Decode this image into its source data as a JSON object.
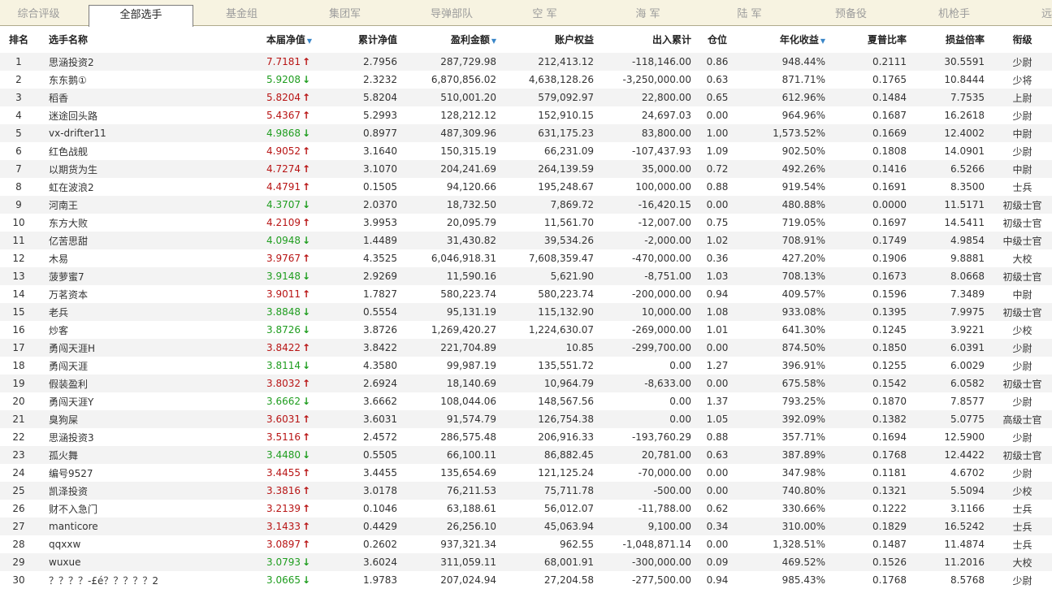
{
  "tabs": [
    "综合评级",
    "全部选手",
    "基金组",
    "集团军",
    "导弹部队",
    "空 军",
    "海 军",
    "陆 军",
    "预备役",
    "机枪手",
    "远征"
  ],
  "active_tab": 1,
  "headers": {
    "rank": "排名",
    "name": "选手名称",
    "nav": "本届净值",
    "cum_nav": "累计净值",
    "profit": "盈利金额",
    "equity": "账户权益",
    "inout": "出入累计",
    "position": "仓位",
    "annual": "年化收益",
    "sharpe": "夏普比率",
    "pl_ratio": "损益倍率",
    "grade": "衔级"
  },
  "sortable_columns": [
    "nav",
    "profit",
    "annual"
  ],
  "colors": {
    "up": "#b81414",
    "down": "#1f9d1f",
    "sort_indicator": "#3a86c8"
  },
  "rows": [
    {
      "rank": "1",
      "name": "思涵投资2",
      "nav": "7.7181",
      "dir": "up",
      "cum": "2.7956",
      "profit": "287,729.98",
      "equity": "212,413.12",
      "inout": "-118,146.00",
      "pos": "0.86",
      "annual": "948.44%",
      "sharpe": "0.2111",
      "ratio": "30.5591",
      "grade": "少尉"
    },
    {
      "rank": "2",
      "name": "东东鹅①",
      "nav": "5.9208",
      "dir": "down",
      "cum": "2.3232",
      "profit": "6,870,856.02",
      "equity": "4,638,128.26",
      "inout": "-3,250,000.00",
      "pos": "0.63",
      "annual": "871.71%",
      "sharpe": "0.1765",
      "ratio": "10.8444",
      "grade": "少将"
    },
    {
      "rank": "3",
      "name": "稻香",
      "nav": "5.8204",
      "dir": "up",
      "cum": "5.8204",
      "profit": "510,001.20",
      "equity": "579,092.97",
      "inout": "22,800.00",
      "pos": "0.65",
      "annual": "612.96%",
      "sharpe": "0.1484",
      "ratio": "7.7535",
      "grade": "上尉"
    },
    {
      "rank": "4",
      "name": "迷途回头路",
      "nav": "5.4367",
      "dir": "up",
      "cum": "5.2993",
      "profit": "128,212.12",
      "equity": "152,910.15",
      "inout": "24,697.03",
      "pos": "0.00",
      "annual": "964.96%",
      "sharpe": "0.1687",
      "ratio": "16.2618",
      "grade": "少尉"
    },
    {
      "rank": "5",
      "name": "vx-drifter11",
      "nav": "4.9868",
      "dir": "down",
      "cum": "0.8977",
      "profit": "487,309.96",
      "equity": "631,175.23",
      "inout": "83,800.00",
      "pos": "1.00",
      "annual": "1,573.52%",
      "sharpe": "0.1669",
      "ratio": "12.4002",
      "grade": "中尉"
    },
    {
      "rank": "6",
      "name": "红色战舰",
      "nav": "4.9052",
      "dir": "up",
      "cum": "3.1640",
      "profit": "150,315.19",
      "equity": "66,231.09",
      "inout": "-107,437.93",
      "pos": "1.09",
      "annual": "902.50%",
      "sharpe": "0.1808",
      "ratio": "14.0901",
      "grade": "少尉"
    },
    {
      "rank": "7",
      "name": "以期货为生",
      "nav": "4.7274",
      "dir": "up",
      "cum": "3.1070",
      "profit": "204,241.69",
      "equity": "264,139.59",
      "inout": "35,000.00",
      "pos": "0.72",
      "annual": "492.26%",
      "sharpe": "0.1416",
      "ratio": "6.5266",
      "grade": "中尉"
    },
    {
      "rank": "8",
      "name": "虹在波浪2",
      "nav": "4.4791",
      "dir": "up",
      "cum": "0.1505",
      "profit": "94,120.66",
      "equity": "195,248.67",
      "inout": "100,000.00",
      "pos": "0.88",
      "annual": "919.54%",
      "sharpe": "0.1691",
      "ratio": "8.3500",
      "grade": "士兵"
    },
    {
      "rank": "9",
      "name": "河南王",
      "nav": "4.3707",
      "dir": "down",
      "cum": "2.0370",
      "profit": "18,732.50",
      "equity": "7,869.72",
      "inout": "-16,420.15",
      "pos": "0.00",
      "annual": "480.88%",
      "sharpe": "0.0000",
      "ratio": "11.5171",
      "grade": "初级士官"
    },
    {
      "rank": "10",
      "name": "东方大败",
      "nav": "4.2109",
      "dir": "up",
      "cum": "3.9953",
      "profit": "20,095.79",
      "equity": "11,561.70",
      "inout": "-12,007.00",
      "pos": "0.75",
      "annual": "719.05%",
      "sharpe": "0.1697",
      "ratio": "14.5411",
      "grade": "初级士官"
    },
    {
      "rank": "11",
      "name": "亿苦思甜",
      "nav": "4.0948",
      "dir": "down",
      "cum": "1.4489",
      "profit": "31,430.82",
      "equity": "39,534.26",
      "inout": "-2,000.00",
      "pos": "1.02",
      "annual": "708.91%",
      "sharpe": "0.1749",
      "ratio": "4.9854",
      "grade": "中级士官"
    },
    {
      "rank": "12",
      "name": "木易",
      "nav": "3.9767",
      "dir": "up",
      "cum": "4.3525",
      "profit": "6,046,918.31",
      "equity": "7,608,359.47",
      "inout": "-470,000.00",
      "pos": "0.36",
      "annual": "427.20%",
      "sharpe": "0.1906",
      "ratio": "9.8881",
      "grade": "大校"
    },
    {
      "rank": "13",
      "name": "菠萝蜜7",
      "nav": "3.9148",
      "dir": "down",
      "cum": "2.9269",
      "profit": "11,590.16",
      "equity": "5,621.90",
      "inout": "-8,751.00",
      "pos": "1.03",
      "annual": "708.13%",
      "sharpe": "0.1673",
      "ratio": "8.0668",
      "grade": "初级士官"
    },
    {
      "rank": "14",
      "name": "万茗资本",
      "nav": "3.9011",
      "dir": "up",
      "cum": "1.7827",
      "profit": "580,223.74",
      "equity": "580,223.74",
      "inout": "-200,000.00",
      "pos": "0.94",
      "annual": "409.57%",
      "sharpe": "0.1596",
      "ratio": "7.3489",
      "grade": "中尉"
    },
    {
      "rank": "15",
      "name": "老兵",
      "nav": "3.8848",
      "dir": "down",
      "cum": "0.5554",
      "profit": "95,131.19",
      "equity": "115,132.90",
      "inout": "10,000.00",
      "pos": "1.08",
      "annual": "933.08%",
      "sharpe": "0.1395",
      "ratio": "7.9975",
      "grade": "初级士官"
    },
    {
      "rank": "16",
      "name": "炒客",
      "nav": "3.8726",
      "dir": "down",
      "cum": "3.8726",
      "profit": "1,269,420.27",
      "equity": "1,224,630.07",
      "inout": "-269,000.00",
      "pos": "1.01",
      "annual": "641.30%",
      "sharpe": "0.1245",
      "ratio": "3.9221",
      "grade": "少校"
    },
    {
      "rank": "17",
      "name": "勇闯天涯H",
      "nav": "3.8422",
      "dir": "up",
      "cum": "3.8422",
      "profit": "221,704.89",
      "equity": "10.85",
      "inout": "-299,700.00",
      "pos": "0.00",
      "annual": "874.50%",
      "sharpe": "0.1850",
      "ratio": "6.0391",
      "grade": "少尉"
    },
    {
      "rank": "18",
      "name": "勇闯天涯",
      "nav": "3.8114",
      "dir": "down",
      "cum": "4.3580",
      "profit": "99,987.19",
      "equity": "135,551.72",
      "inout": "0.00",
      "pos": "1.27",
      "annual": "396.91%",
      "sharpe": "0.1255",
      "ratio": "6.0029",
      "grade": "少尉"
    },
    {
      "rank": "19",
      "name": "假装盈利",
      "nav": "3.8032",
      "dir": "up",
      "cum": "2.6924",
      "profit": "18,140.69",
      "equity": "10,964.79",
      "inout": "-8,633.00",
      "pos": "0.00",
      "annual": "675.58%",
      "sharpe": "0.1542",
      "ratio": "6.0582",
      "grade": "初级士官"
    },
    {
      "rank": "20",
      "name": "勇闯天涯Y",
      "nav": "3.6662",
      "dir": "down",
      "cum": "3.6662",
      "profit": "108,044.06",
      "equity": "148,567.56",
      "inout": "0.00",
      "pos": "1.37",
      "annual": "793.25%",
      "sharpe": "0.1870",
      "ratio": "7.8577",
      "grade": "少尉"
    },
    {
      "rank": "21",
      "name": "臭狗屎",
      "nav": "3.6031",
      "dir": "up",
      "cum": "3.6031",
      "profit": "91,574.79",
      "equity": "126,754.38",
      "inout": "0.00",
      "pos": "1.05",
      "annual": "392.09%",
      "sharpe": "0.1382",
      "ratio": "5.0775",
      "grade": "高级士官"
    },
    {
      "rank": "22",
      "name": "思涵投资3",
      "nav": "3.5116",
      "dir": "up",
      "cum": "2.4572",
      "profit": "286,575.48",
      "equity": "206,916.33",
      "inout": "-193,760.29",
      "pos": "0.88",
      "annual": "357.71%",
      "sharpe": "0.1694",
      "ratio": "12.5900",
      "grade": "少尉"
    },
    {
      "rank": "23",
      "name": "孤火舞",
      "nav": "3.4480",
      "dir": "down",
      "cum": "0.5505",
      "profit": "66,100.11",
      "equity": "86,882.45",
      "inout": "20,781.00",
      "pos": "0.63",
      "annual": "387.89%",
      "sharpe": "0.1768",
      "ratio": "12.4422",
      "grade": "初级士官"
    },
    {
      "rank": "24",
      "name": "编号9527",
      "nav": "3.4455",
      "dir": "up",
      "cum": "3.4455",
      "profit": "135,654.69",
      "equity": "121,125.24",
      "inout": "-70,000.00",
      "pos": "0.00",
      "annual": "347.98%",
      "sharpe": "0.1181",
      "ratio": "4.6702",
      "grade": "少尉"
    },
    {
      "rank": "25",
      "name": "凯泽投资",
      "nav": "3.3816",
      "dir": "up",
      "cum": "3.0178",
      "profit": "76,211.53",
      "equity": "75,711.78",
      "inout": "-500.00",
      "pos": "0.00",
      "annual": "740.80%",
      "sharpe": "0.1321",
      "ratio": "5.5094",
      "grade": "少校"
    },
    {
      "rank": "26",
      "name": "财不入急门",
      "nav": "3.2139",
      "dir": "up",
      "cum": "0.1046",
      "profit": "63,188.61",
      "equity": "56,012.07",
      "inout": "-11,788.00",
      "pos": "0.62",
      "annual": "330.66%",
      "sharpe": "0.1222",
      "ratio": "3.1166",
      "grade": "士兵"
    },
    {
      "rank": "27",
      "name": "manticore",
      "nav": "3.1433",
      "dir": "up",
      "cum": "0.4429",
      "profit": "26,256.10",
      "equity": "45,063.94",
      "inout": "9,100.00",
      "pos": "0.34",
      "annual": "310.00%",
      "sharpe": "0.1829",
      "ratio": "16.5242",
      "grade": "士兵"
    },
    {
      "rank": "28",
      "name": "qqxxw",
      "nav": "3.0897",
      "dir": "up",
      "cum": "0.2602",
      "profit": "937,321.34",
      "equity": "962.55",
      "inout": "-1,048,871.14",
      "pos": "0.00",
      "annual": "1,328.51%",
      "sharpe": "0.1487",
      "ratio": "11.4874",
      "grade": "士兵"
    },
    {
      "rank": "29",
      "name": "wuxue",
      "nav": "3.0793",
      "dir": "down",
      "cum": "3.6024",
      "profit": "311,059.11",
      "equity": "68,001.91",
      "inout": "-300,000.00",
      "pos": "0.09",
      "annual": "469.52%",
      "sharpe": "0.1526",
      "ratio": "11.2016",
      "grade": "大校"
    },
    {
      "rank": "30",
      "name": "？？？？-£é？？？？？2",
      "nav": "3.0665",
      "dir": "down",
      "cum": "1.9783",
      "profit": "207,024.94",
      "equity": "27,204.58",
      "inout": "-277,500.00",
      "pos": "0.94",
      "annual": "985.43%",
      "sharpe": "0.1768",
      "ratio": "8.5768",
      "grade": "少尉"
    }
  ]
}
